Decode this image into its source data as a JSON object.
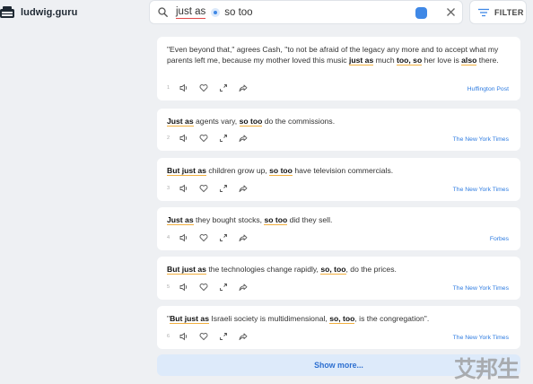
{
  "site": {
    "name": "ludwig.guru"
  },
  "search": {
    "term_1": "just as",
    "term_2": "so too"
  },
  "filter": {
    "label": "FILTER"
  },
  "results": [
    {
      "parts": [
        {
          "t": "\"Even beyond that,\" agrees Cash, \"to not be afraid of the legacy any more and to accept what my parents left me, because my mother loved this music "
        },
        {
          "b": "just as"
        },
        {
          "t": " much "
        },
        {
          "b": "too, so"
        },
        {
          "t": " her love is "
        },
        {
          "b": "also"
        },
        {
          "t": " there."
        }
      ],
      "index": "1",
      "source": "Huffington Post"
    },
    {
      "parts": [
        {
          "b": "Just as"
        },
        {
          "t": " agents vary, "
        },
        {
          "b": "so too"
        },
        {
          "t": " do the commissions."
        }
      ],
      "index": "2",
      "source": "The New York Times"
    },
    {
      "parts": [
        {
          "b": "But just as"
        },
        {
          "t": " children grow up, "
        },
        {
          "b": "so too"
        },
        {
          "t": " have television commercials."
        }
      ],
      "index": "3",
      "source": "The New York Times"
    },
    {
      "parts": [
        {
          "b": "Just as"
        },
        {
          "t": " they bought stocks, "
        },
        {
          "b": "so too"
        },
        {
          "t": " did they sell."
        }
      ],
      "index": "4",
      "source": "Forbes"
    },
    {
      "parts": [
        {
          "b": "But just as"
        },
        {
          "t": " the technologies change rapidly, "
        },
        {
          "b": "so, too"
        },
        {
          "t": ", do the prices."
        }
      ],
      "index": "5",
      "source": "The New York Times"
    },
    {
      "parts": [
        {
          "t": "\""
        },
        {
          "b": "But just as"
        },
        {
          "t": " Israeli society is multidimensional, "
        },
        {
          "b": "so, too"
        },
        {
          "t": ", is the congregation\"."
        }
      ],
      "index": "6",
      "source": "The New York Times"
    }
  ],
  "show_more": {
    "label": "Show more..."
  },
  "watermark": {
    "text": "艾邦生"
  },
  "icons": [
    "typewriter-icon",
    "search-icon",
    "wildcard-icon",
    "close-icon",
    "filter-icon",
    "speaker-icon",
    "heart-icon",
    "expand-icon",
    "share-icon"
  ],
  "colors": {
    "link": "#2d7be0",
    "highlight_underline": "#f2b040",
    "show_more_bg": "#ddeafa",
    "badge": "#3f88e6"
  }
}
